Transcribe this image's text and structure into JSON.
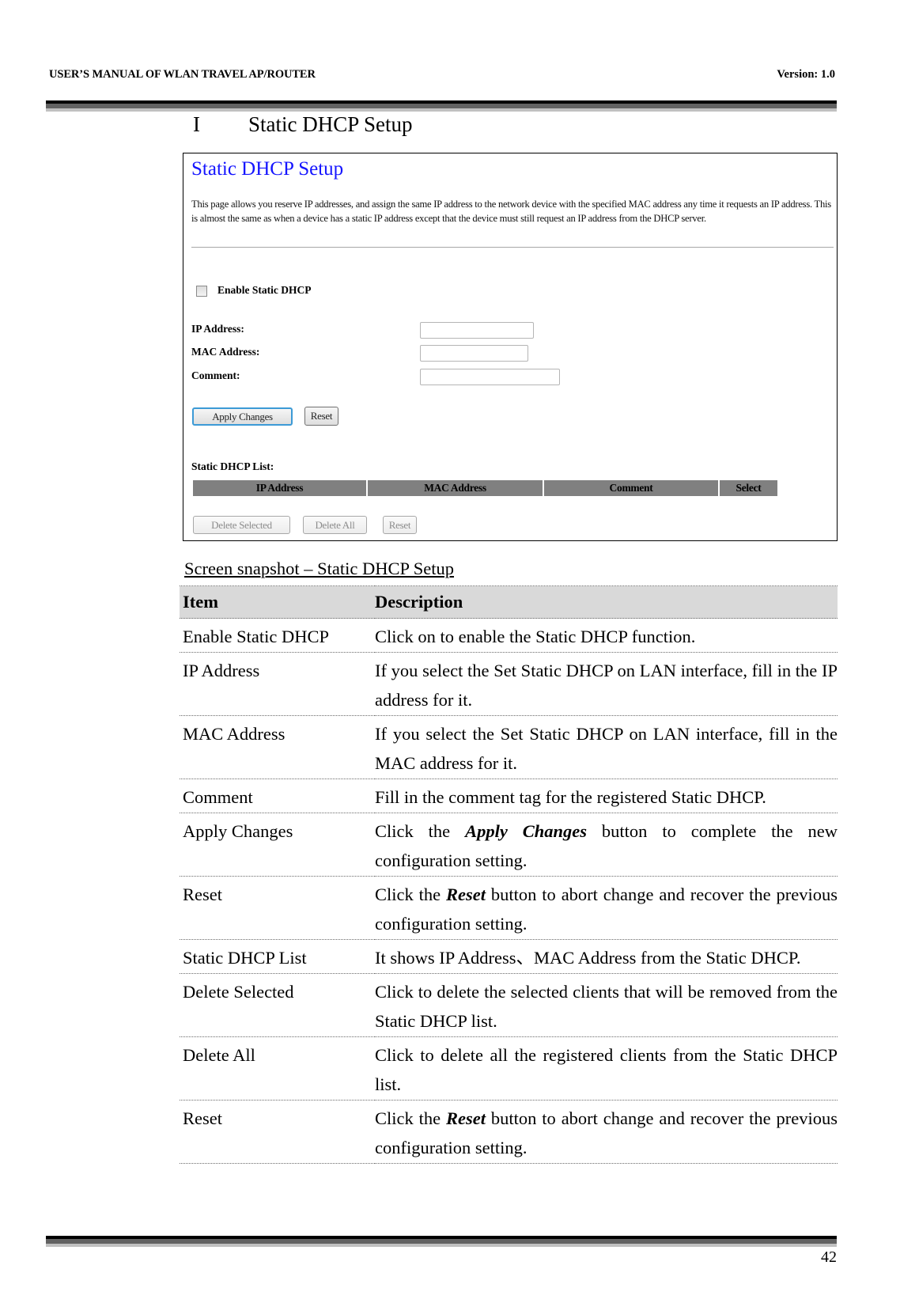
{
  "header": {
    "manual_title": "USER’S MANUAL OF WLAN TRAVEL AP/ROUTER",
    "version": "Version: 1.0"
  },
  "section": {
    "number": "I",
    "title": "Static DHCP Setup"
  },
  "screenshot": {
    "title": "Static DHCP Setup",
    "description": "This page allows you reserve IP addresses, and assign the same IP address to the network device with the specified MAC address any time it requests an IP address. This is almost the same as when a device has a static IP address except that the device must still request an IP address from the DHCP server.",
    "enable_label": "Enable Static DHCP",
    "enable_checked": false,
    "fields": [
      {
        "label": "IP Address:",
        "value": ""
      },
      {
        "label": "MAC Address:",
        "value": ""
      },
      {
        "label": "Comment:",
        "value": ""
      }
    ],
    "apply_button": "Apply Changes",
    "reset_button": "Reset",
    "list_label": "Static DHCP List:",
    "list_columns": [
      "IP Address",
      "MAC Address",
      "Comment",
      "Select"
    ],
    "list_rows": [],
    "delete_selected_button": "Delete Selected",
    "delete_all_button": "Delete All",
    "list_reset_button": "Reset",
    "colors": {
      "title": "#1515ff",
      "table_header": "#808080",
      "apply_border": "#3c9ad6"
    }
  },
  "caption": "Screen snapshot – Static DHCP Setup",
  "table": {
    "headers": [
      "Item",
      "Description"
    ],
    "rows": [
      {
        "item": "Enable Static DHCP",
        "pre": "Click on to enable the Static DHCP function.",
        "em": "",
        "post": ""
      },
      {
        "item": "IP Address",
        "pre": "If you select the Set Static DHCP on LAN interface, fill in the IP address for it.",
        "em": "",
        "post": ""
      },
      {
        "item": "MAC Address",
        "pre": "If you select the Set Static DHCP on LAN interface, fill in the MAC address for it.",
        "em": "",
        "post": ""
      },
      {
        "item": "Comment",
        "pre": "Fill in the comment tag for the registered Static DHCP.",
        "em": "",
        "post": ""
      },
      {
        "item": "Apply Changes",
        "pre": "Click the ",
        "em": "Apply Changes",
        "post": " button to complete the new configuration setting."
      },
      {
        "item": "Reset",
        "pre": "Click the ",
        "em": "Reset",
        "post": " button to abort change and recover the previous configuration setting."
      },
      {
        "item": "Static DHCP List",
        "pre": "It shows IP Address、MAC Address from the Static DHCP.",
        "em": "",
        "post": ""
      },
      {
        "item": "Delete Selected",
        "pre": "Click to delete the selected clients that will be removed from the Static DHCP list.",
        "em": "",
        "post": ""
      },
      {
        "item": "Delete All",
        "pre": "Click to delete all the registered clients from the Static DHCP list.",
        "em": "",
        "post": ""
      },
      {
        "item": "Reset",
        "pre": "Click the ",
        "em": "Reset",
        "post": " button to abort change and recover the previous configuration setting."
      }
    ],
    "header_bg": "#d9d9d9"
  },
  "footer": {
    "page_number": "42"
  }
}
